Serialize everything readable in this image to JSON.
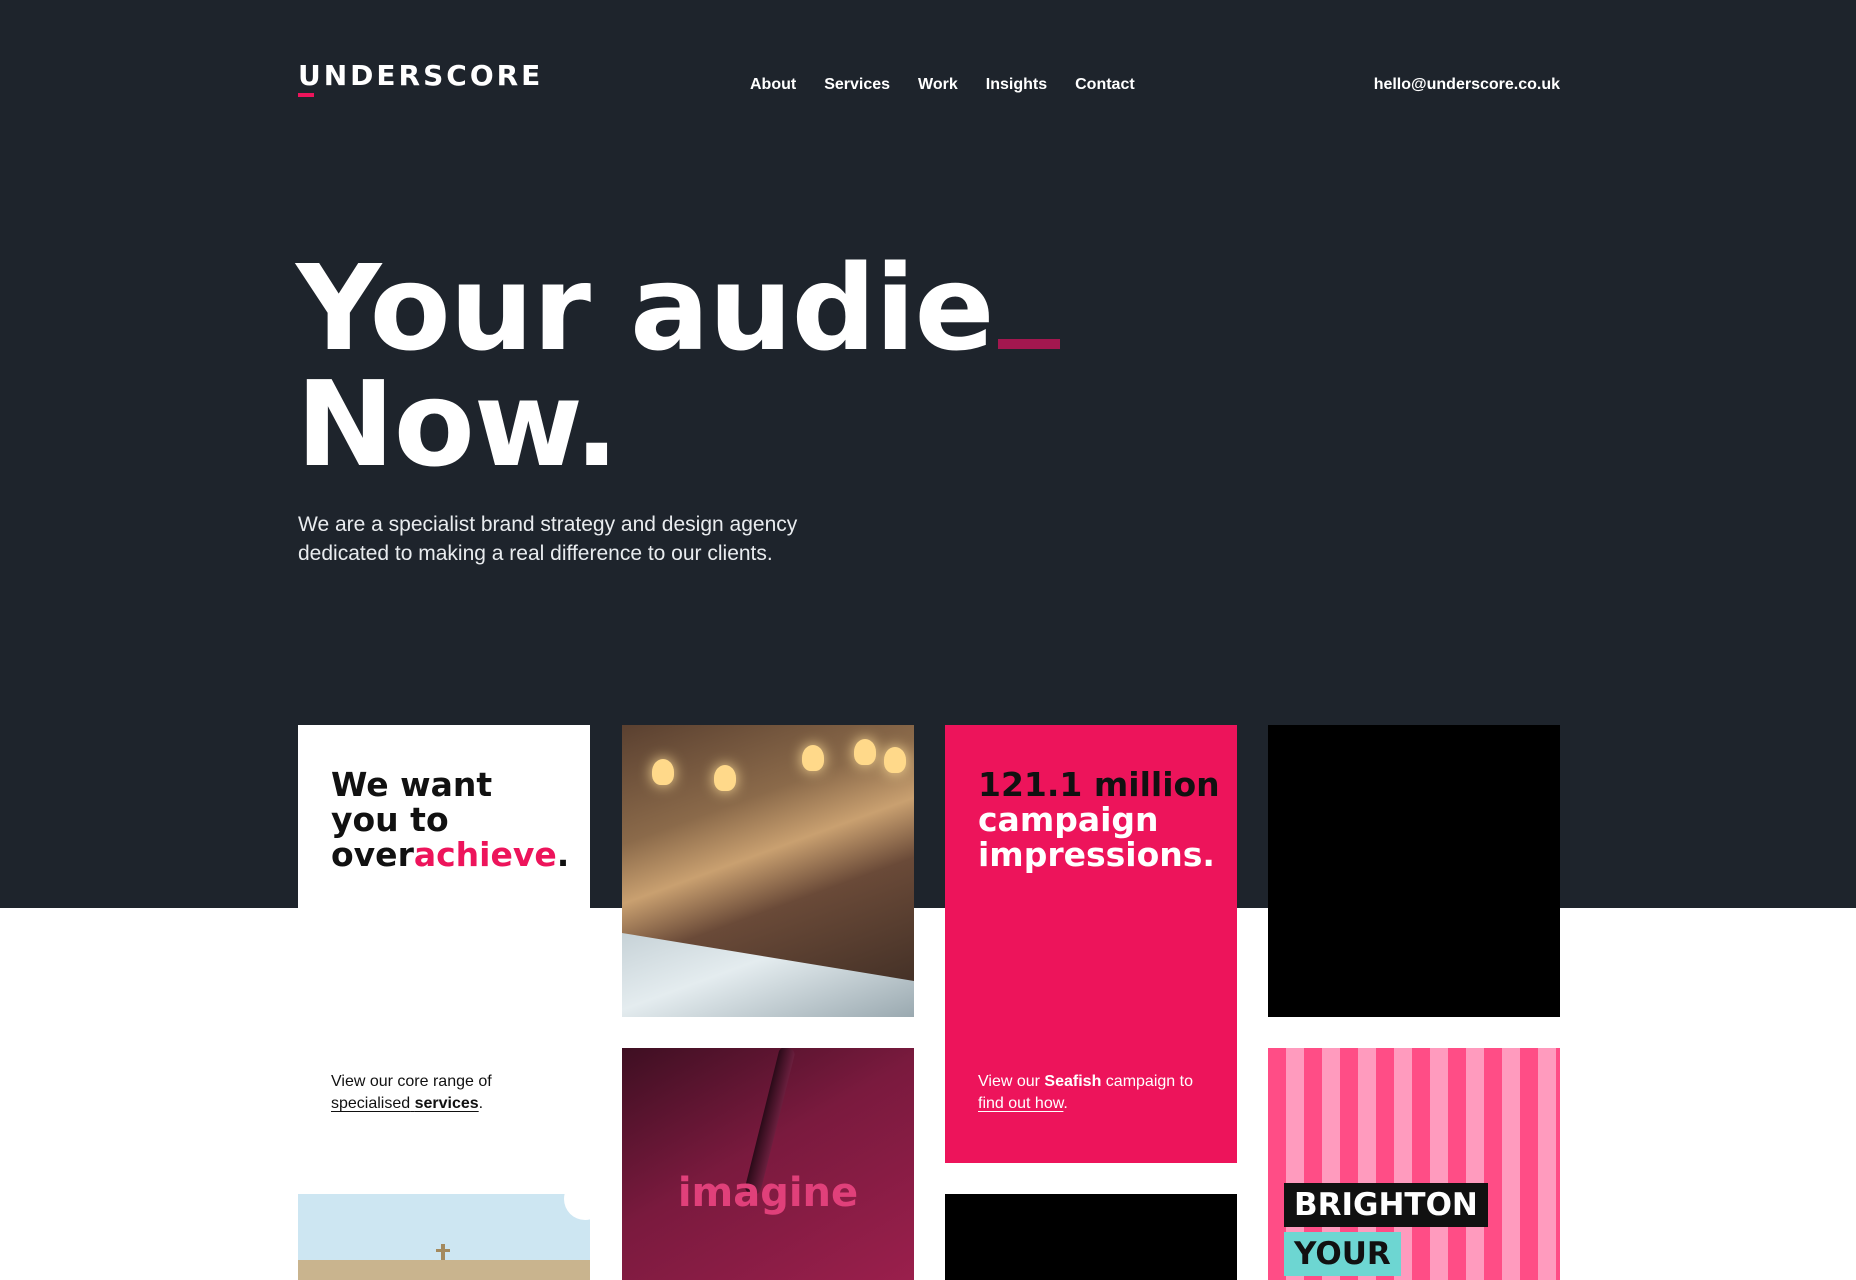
{
  "brand": {
    "logo_text": "UNDERSCORE",
    "accent_color": "#ed145b",
    "dark_bg": "#1e242c"
  },
  "nav": {
    "items": [
      "About",
      "Services",
      "Work",
      "Insights",
      "Contact"
    ]
  },
  "header": {
    "email": "hello@underscore.co.uk"
  },
  "hero": {
    "headline_line1": "Your audie",
    "headline_line2": "Now.",
    "intro": "We are a specialist brand strategy and design agency dedicated to making a real difference to our clients."
  },
  "cards": {
    "overachieve": {
      "line1": "We want",
      "line2": "you to",
      "line3_plain": "over",
      "line3_accent": "achieve",
      "line3_end": ".",
      "body_prefix": "View our core range of",
      "link_plain": "specialised",
      "link_bold": "services",
      "body_end": "."
    },
    "seafish": {
      "stat": "121.1 million",
      "line2": "campaign",
      "line3": "impressions.",
      "body_prefix": "View our",
      "body_bold": "Seafish",
      "body_mid": "campaign to",
      "link": "find out how",
      "body_end": "."
    },
    "imagine": {
      "word": "imagine"
    },
    "brighton": {
      "tag1": "BRIGHTON",
      "tag2": "YOUR"
    }
  }
}
